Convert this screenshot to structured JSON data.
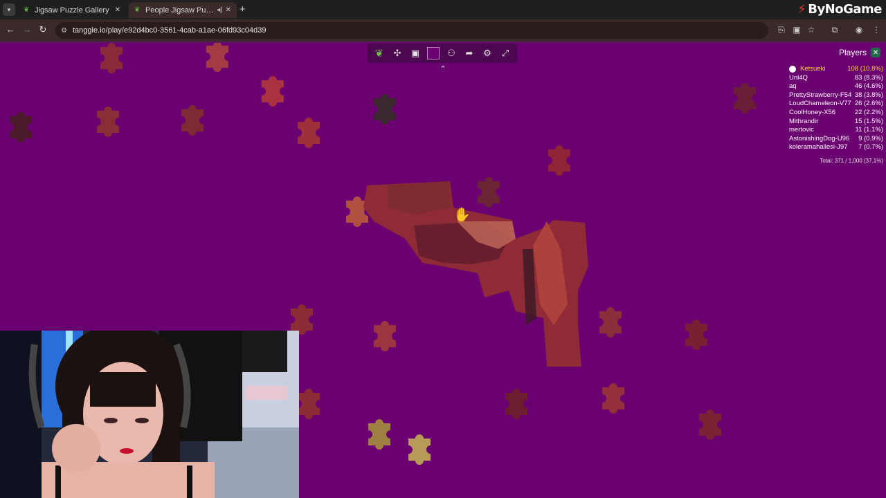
{
  "browser": {
    "tab_inactive_label": "Jigsaw Puzzle Gallery",
    "tab_active_label": "People Jigsaw Puzzle",
    "url": "tanggle.io/play/e92d4bc0-3561-4cab-a1ae-06fd93c04d39",
    "brand_name": "ByNoGame"
  },
  "puzzle_toolbar": {
    "icons": [
      "tanggle-logo-icon",
      "pieces-icon",
      "preview-image-icon",
      "background-color-swatch",
      "players-icon",
      "share-icon",
      "settings-icon",
      "fullscreen-icon"
    ],
    "background_color": "#6b0070"
  },
  "players": {
    "title": "Players",
    "rows": [
      {
        "name": "Ketsueki",
        "score": "108 (10.8%)"
      },
      {
        "name": "Unl4Q",
        "score": "83 (8.3%)"
      },
      {
        "name": "aq",
        "score": "46 (4.6%)"
      },
      {
        "name": "PrettyStrawberry-F54",
        "score": "38 (3.8%)"
      },
      {
        "name": "LoudChameleon-V77",
        "score": "26 (2.6%)"
      },
      {
        "name": "CoolHoney-X56",
        "score": "22 (2.2%)"
      },
      {
        "name": "Mithrandir",
        "score": "15 (1.5%)"
      },
      {
        "name": "mertovic",
        "score": "11 (1.1%)"
      },
      {
        "name": "AstonishingDog-U96",
        "score": "9 (0.9%)"
      },
      {
        "name": "koleramahallesi-J97",
        "score": "7 (0.7%)"
      }
    ],
    "total": "Total: 371 / 1,000 (37.1%)"
  }
}
